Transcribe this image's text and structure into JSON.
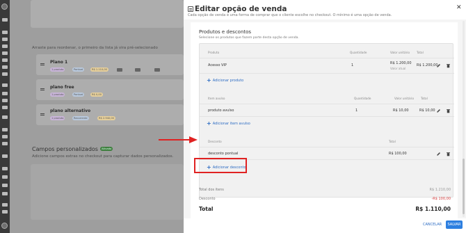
{
  "background_page": {
    "plans_hint": "Arraste para reordenar, o primeiro da lista já vira pré-selecionado",
    "plans": [
      {
        "name": "Plano 1",
        "tags": [
          "1 produto",
          "Pontual",
          "R$ 1.110,00"
        ]
      },
      {
        "name": "plano free",
        "tags": [
          "1 produto",
          "Pontual",
          "R$ 0,00"
        ]
      },
      {
        "name": "plano alternativo",
        "tags": [
          "1 produto",
          "Recorrente",
          "R$ 2.940,00"
        ]
      }
    ],
    "custom_fields_title": "Campos personalizados",
    "custom_fields_badge": "Ativado",
    "custom_fields_desc": "Adicione campos extras no checkout para capturar dados personalizados."
  },
  "drawer": {
    "title": "Editar opção de venda",
    "subtitle": "Cada opção de venda é uma forma de comprar que o cliente escolhe no checkout. O mínimo é uma opção de venda.",
    "section_title": "Produtos e descontos",
    "section_subtitle": "Selecione os produtos que fazem parte desta opção de venda.",
    "products_table": {
      "headers": {
        "product": "Produto",
        "quantity": "Quantidade",
        "unit_value": "Valor unitário",
        "total": "Total"
      },
      "rows": [
        {
          "name": "Acesso VIP",
          "quantity": "1",
          "unit_value": "R$ 1.200,00",
          "unit_note": "Valor atual",
          "total": "R$ 1.200,00"
        }
      ],
      "add_label": "Adicionar produto"
    },
    "loose_items_table": {
      "headers": {
        "item": "Item avulso",
        "quantity": "Quantidade",
        "unit_value": "Valor unitário",
        "total": "Total"
      },
      "rows": [
        {
          "name": "produto avulso",
          "quantity": "1",
          "unit_value": "R$ 10,00",
          "total": "R$ 10,00"
        }
      ],
      "add_label": "Adicionar item avulso"
    },
    "discounts_table": {
      "headers": {
        "discount": "Desconto",
        "total": "Total"
      },
      "rows": [
        {
          "name": "desconto pontual",
          "total": "R$ 100,00"
        }
      ],
      "add_label": "Adicionar desconto"
    },
    "summary": {
      "items_total_label": "Total dos itens",
      "items_total_value": "R$ 1.210,00",
      "discount_label": "Desconto",
      "discount_value": "-R$ 100,00",
      "total_label": "Total",
      "total_value": "R$ 1.110,00"
    },
    "footer": {
      "cancel_label": "CANCELAR",
      "save_label": "SALVAR"
    }
  },
  "colors": {
    "accent": "#2d6cc3",
    "save_button": "#2d7fe0",
    "negative": "#d33b3b",
    "annotation": "#e02222"
  }
}
